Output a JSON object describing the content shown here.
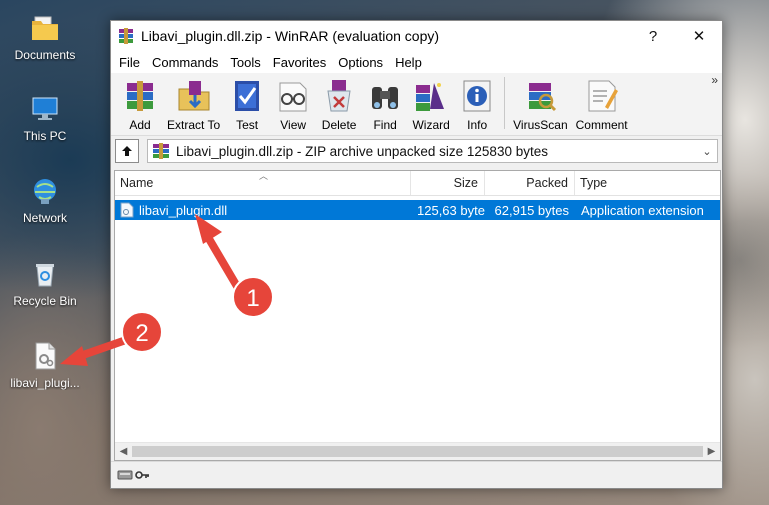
{
  "desktop": {
    "icons": [
      {
        "label": "Documents",
        "icon": "folder-icon"
      },
      {
        "label": "This PC",
        "icon": "computer-icon"
      },
      {
        "label": "Network",
        "icon": "network-icon"
      },
      {
        "label": "Recycle Bin",
        "icon": "recycle-bin-icon"
      },
      {
        "label": "libavi_plugi...",
        "icon": "dll-file-icon"
      }
    ]
  },
  "window": {
    "title": "Libavi_plugin.dll.zip - WinRAR (evaluation copy)",
    "help_glyph": "?",
    "close_glyph": "✕"
  },
  "menu": [
    "File",
    "Commands",
    "Tools",
    "Favorites",
    "Options",
    "Help"
  ],
  "toolbar": {
    "buttons": [
      {
        "label": "Add",
        "icon": "add-archive-icon"
      },
      {
        "label": "Extract To",
        "icon": "extract-folder-icon"
      },
      {
        "label": "Test",
        "icon": "test-checkmark-icon"
      },
      {
        "label": "View",
        "icon": "view-glasses-icon"
      },
      {
        "label": "Delete",
        "icon": "delete-recycle-icon"
      },
      {
        "label": "Find",
        "icon": "find-binoculars-icon"
      },
      {
        "label": "Wizard",
        "icon": "wizard-icon"
      },
      {
        "label": "Info",
        "icon": "info-icon"
      },
      {
        "label": "VirusScan",
        "icon": "virus-scan-icon"
      },
      {
        "label": "Comment",
        "icon": "comment-icon"
      }
    ],
    "more_glyph": "»"
  },
  "address": {
    "path": "Libavi_plugin.dll.zip - ZIP archive unpacked size 125830 bytes"
  },
  "columns": {
    "name": "Name",
    "size": "Size",
    "packed": "Packed",
    "type": "Type"
  },
  "files": [
    {
      "name": "libavi_plugin.dll",
      "size": "125,63 byte",
      "packed": "62,915 bytes",
      "type": "Application extension"
    }
  ],
  "annotations": {
    "step1": "1",
    "step2": "2",
    "color": "#e6453a"
  }
}
